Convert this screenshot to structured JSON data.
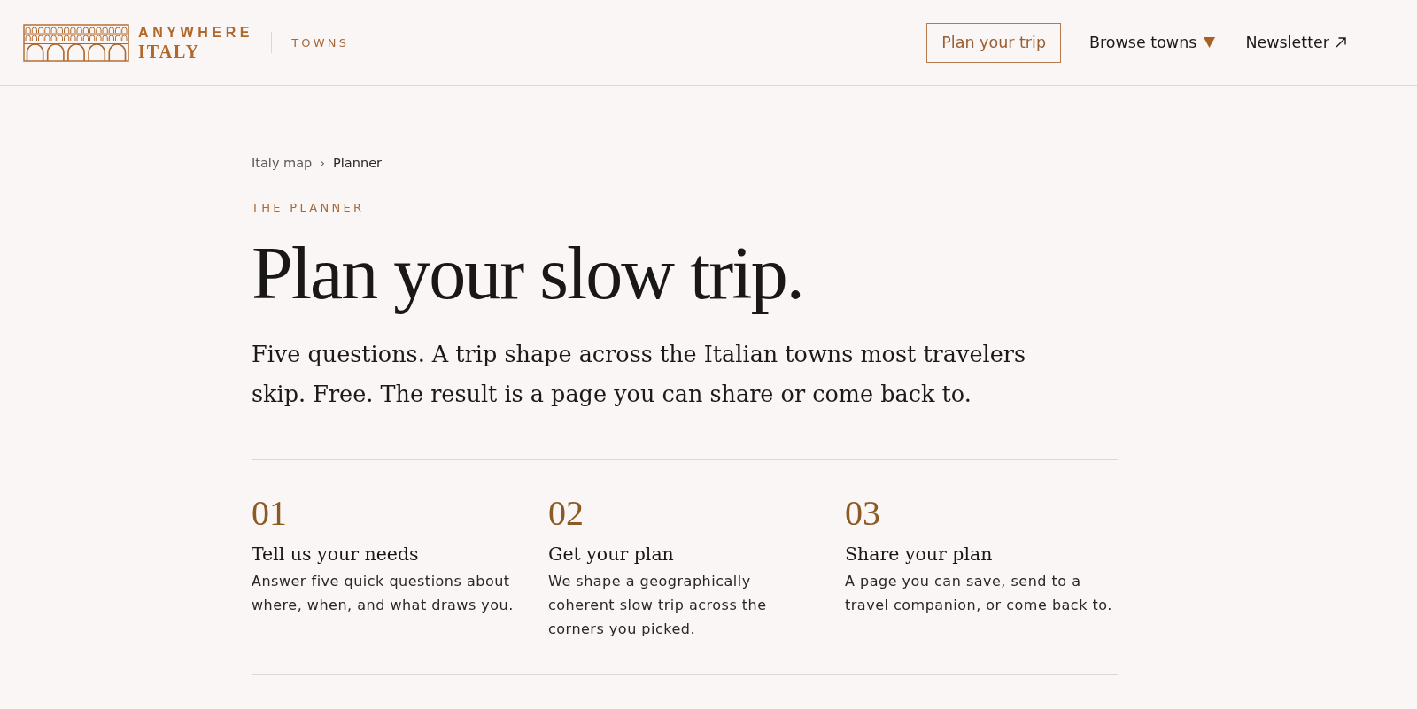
{
  "header": {
    "logo": {
      "line_1": "ANYWHERE",
      "line_2": "ITALY"
    },
    "section": "TOWNS",
    "nav": [
      {
        "kind": "button",
        "label": "Plan your trip"
      },
      {
        "kind": "dropdown",
        "label": "Browse towns"
      },
      {
        "kind": "external",
        "label": "Newsletter"
      }
    ]
  },
  "breadcrumb": {
    "separator": "›",
    "items": [
      {
        "label": "Italy map",
        "current": false
      },
      {
        "label": "Planner",
        "current": true
      }
    ]
  },
  "hero": {
    "eyebrow": "THE PLANNER",
    "title": "Plan your slow trip.",
    "lead": "Five questions. A trip shape across the Italian towns most travelers\nskip. Free. The result is a page you can share or come back to."
  },
  "steps": [
    {
      "number": "01",
      "title": "Tell us your needs",
      "text": "Answer five quick questions about\nwhere, when, and what draws you."
    },
    {
      "number": "02",
      "title": "Get your plan",
      "text": "We shape a geographically\ncoherent slow trip across the\ncorners you picked."
    },
    {
      "number": "03",
      "title": "Share your plan",
      "text": "A page you can save, send to a\ntravel companion, or come back to."
    }
  ]
}
